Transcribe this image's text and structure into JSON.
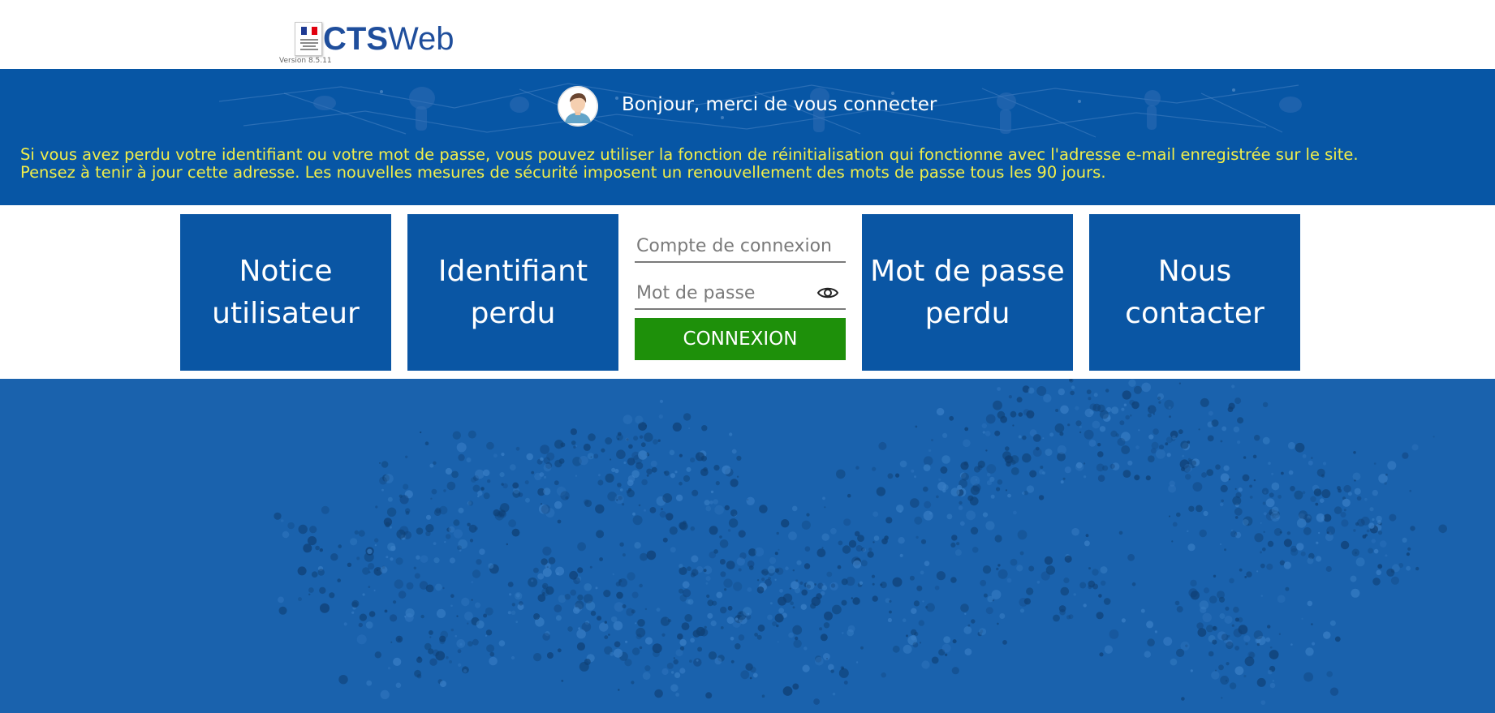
{
  "header": {
    "brand_bold": "CTS",
    "brand_light": "Web",
    "version": "Version 8.5.11",
    "flag_colors": [
      "#1f3a93",
      "#ffffff",
      "#e1000f"
    ]
  },
  "welcome": {
    "greeting": "Bonjour, merci de vous connecter",
    "notice_line1": "Si vous avez perdu votre identifiant ou votre mot de passe, vous pouvez utiliser la fonction de réinitialisation qui fonctionne avec l'adresse e-mail enregistrée sur le site.",
    "notice_line2": "Pensez à tenir à jour cette adresse. Les nouvelles mesures de sécurité imposent un renouvellement des mots de passe tous les 90 jours."
  },
  "tiles": {
    "user_guide": "Notice\nutilisateur",
    "lost_id": "Identifiant\nperdu",
    "lost_password": "Mot de passe\nperdu",
    "contact": "Nous\ncontacter"
  },
  "login": {
    "account_placeholder": "Compte de connexion",
    "account_value": "",
    "password_placeholder": "Mot de passe",
    "password_value": "",
    "submit_label": "CONNEXION"
  },
  "icons": {
    "avatar": "user-avatar-icon",
    "password_toggle": "eye-icon",
    "logo": "republique-francaise-logo"
  },
  "colors": {
    "brand_blue": "#0756a5",
    "tile_blue": "#0a56a4",
    "notice_yellow": "#f1ee4a",
    "connect_green": "#1e900a",
    "background_blue": "#1a62ad",
    "brand_text": "#1f4e9c"
  }
}
